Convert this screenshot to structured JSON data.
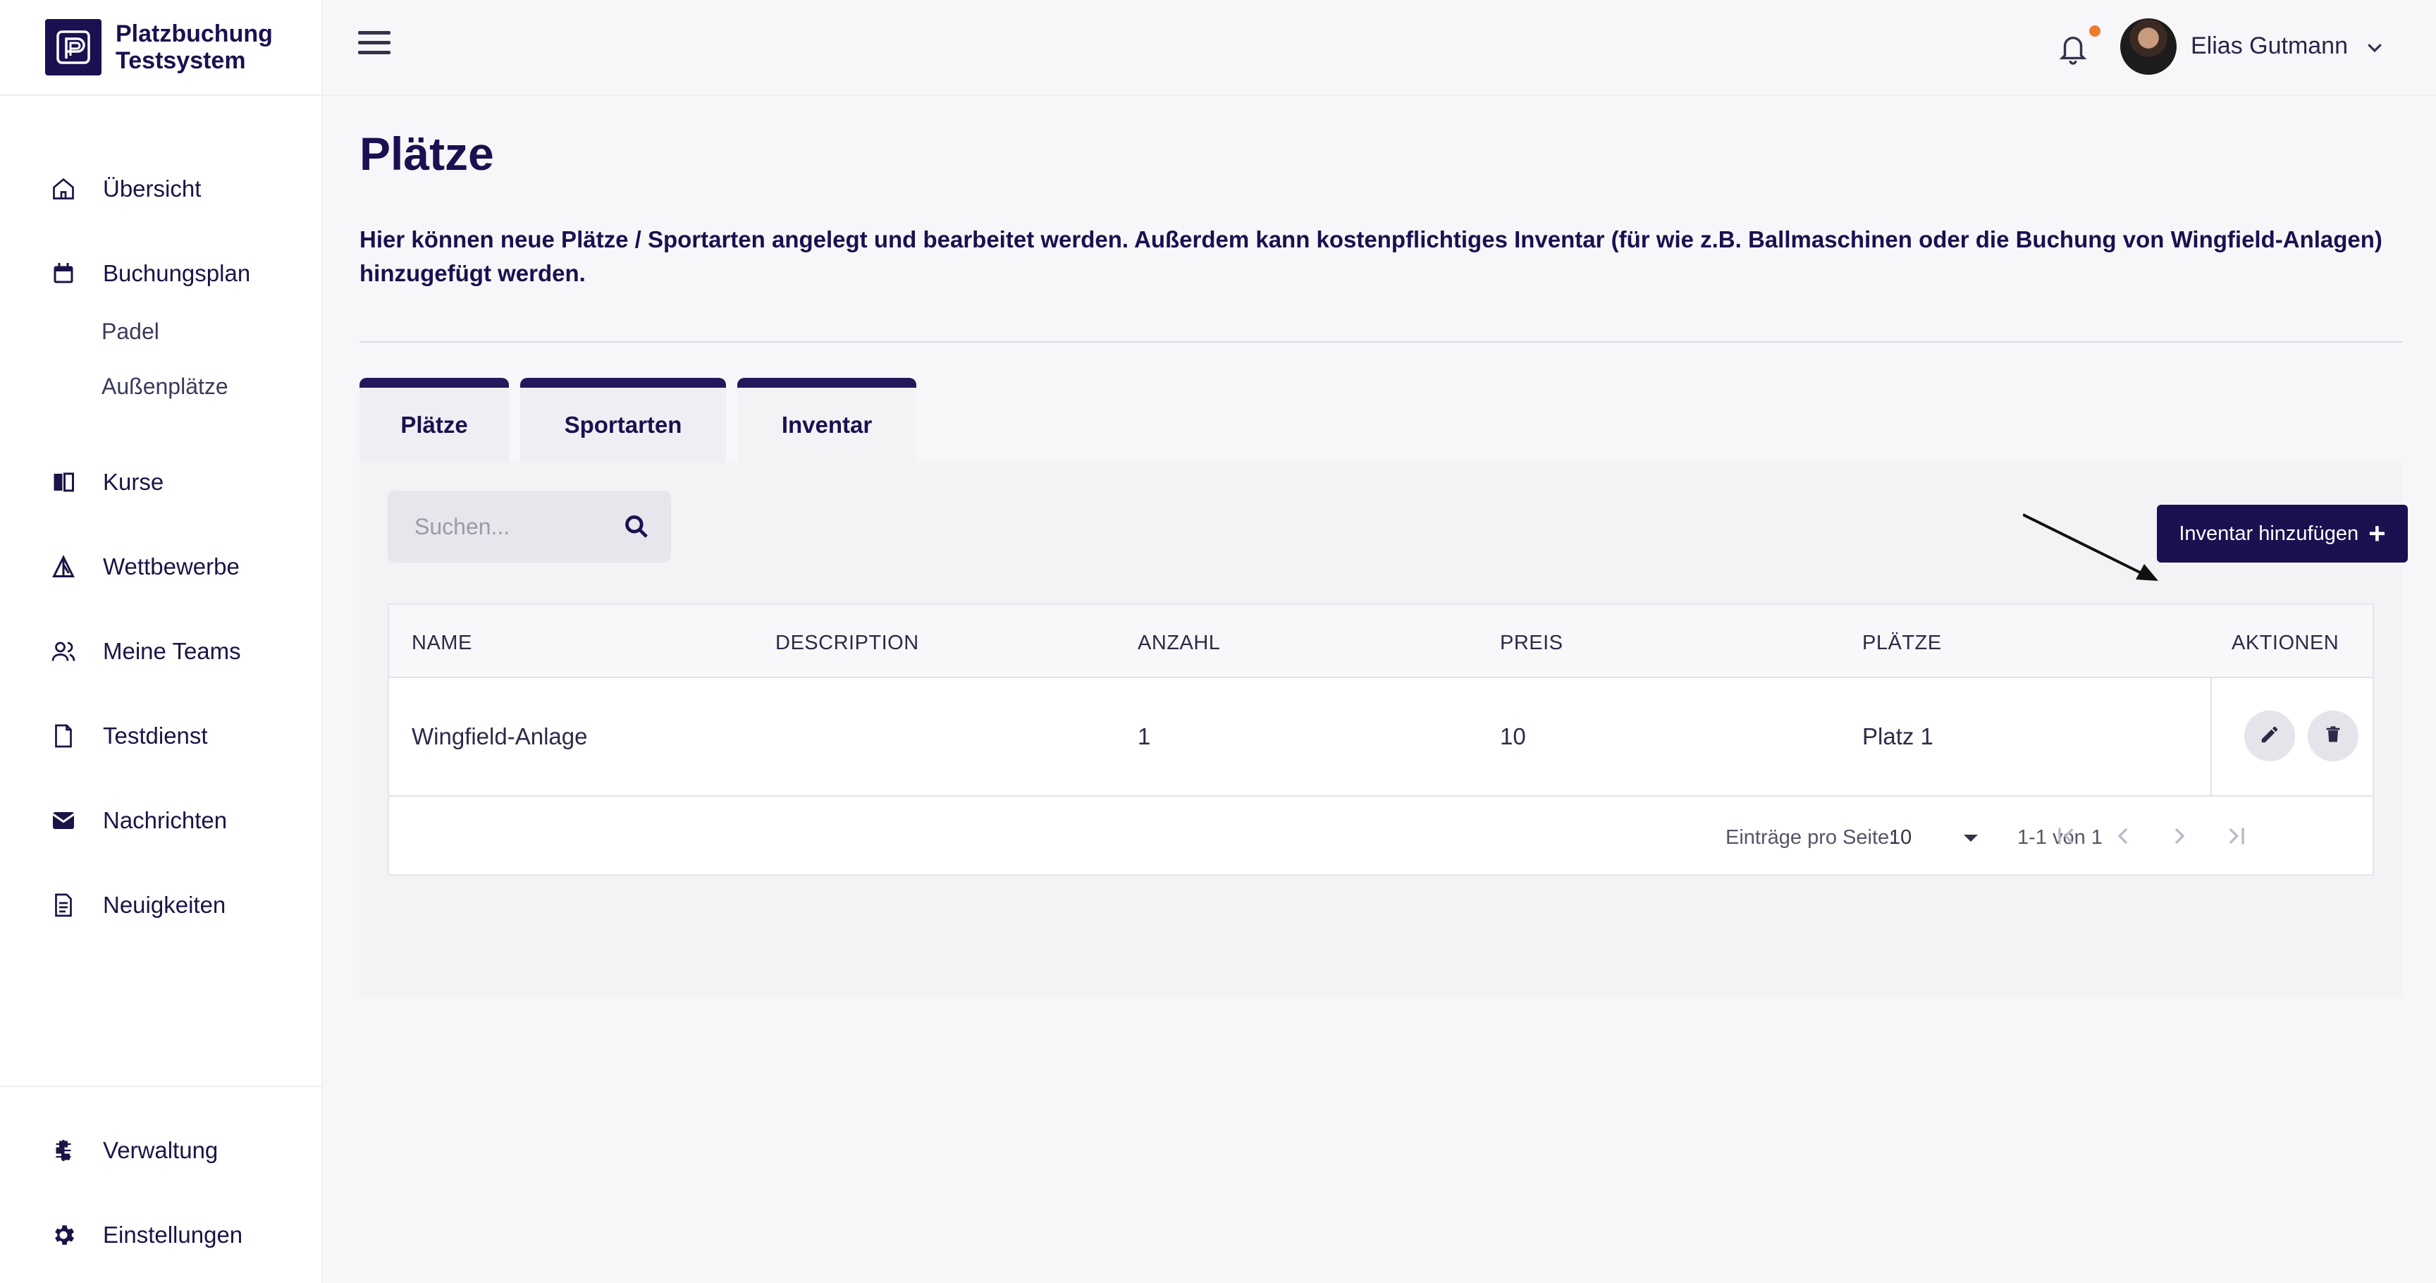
{
  "brand": {
    "line1": "Platzbuchung",
    "line2": "Testsystem"
  },
  "sidebar": {
    "items": [
      {
        "label": "Übersicht",
        "icon": "home-icon"
      },
      {
        "label": "Buchungsplan",
        "icon": "calendar-icon"
      },
      {
        "label": "Kurse",
        "icon": "book-icon"
      },
      {
        "label": "Wettbewerbe",
        "icon": "competition-icon"
      },
      {
        "label": "Meine Teams",
        "icon": "users-icon"
      },
      {
        "label": "Testdienst",
        "icon": "document-icon"
      },
      {
        "label": "Nachrichten",
        "icon": "mail-icon"
      },
      {
        "label": "Neuigkeiten",
        "icon": "news-icon"
      }
    ],
    "subitems": [
      {
        "label": "Padel"
      },
      {
        "label": "Außenplätze"
      }
    ],
    "bottom_items": [
      {
        "label": "Verwaltung",
        "icon": "sliders-icon"
      },
      {
        "label": "Einstellungen",
        "icon": "gear-icon"
      }
    ]
  },
  "header": {
    "user_name": "Elias Gutmann"
  },
  "page": {
    "title": "Plätze",
    "description": "Hier können neue Plätze / Sportarten angelegt und bearbeitet werden. Außerdem kann kostenpflichtiges Inventar (für wie z.B. Ballmaschinen oder die Buchung von Wingfield-Anlagen) hinzugefügt werden."
  },
  "tabs": [
    {
      "label": "Plätze"
    },
    {
      "label": "Sportarten"
    },
    {
      "label": "Inventar",
      "active": true
    }
  ],
  "search": {
    "placeholder": "Suchen..."
  },
  "add_button": {
    "label": "Inventar hinzufügen"
  },
  "table": {
    "columns": [
      "NAME",
      "DESCRIPTION",
      "ANZAHL",
      "PREIS",
      "PLÄTZE",
      "AKTIONEN"
    ],
    "rows": [
      {
        "name": "Wingfield-Anlage",
        "description": "",
        "anzahl": "1",
        "preis": "10",
        "plaetze": "Platz 1"
      }
    ]
  },
  "pagination": {
    "per_page_label": "Einträge pro Seite:",
    "per_page_value": "10",
    "range": "1-1 von 1"
  },
  "colors": {
    "primary": "#1b1050",
    "accent": "#f07b2e",
    "tab_border": "#24185c"
  }
}
